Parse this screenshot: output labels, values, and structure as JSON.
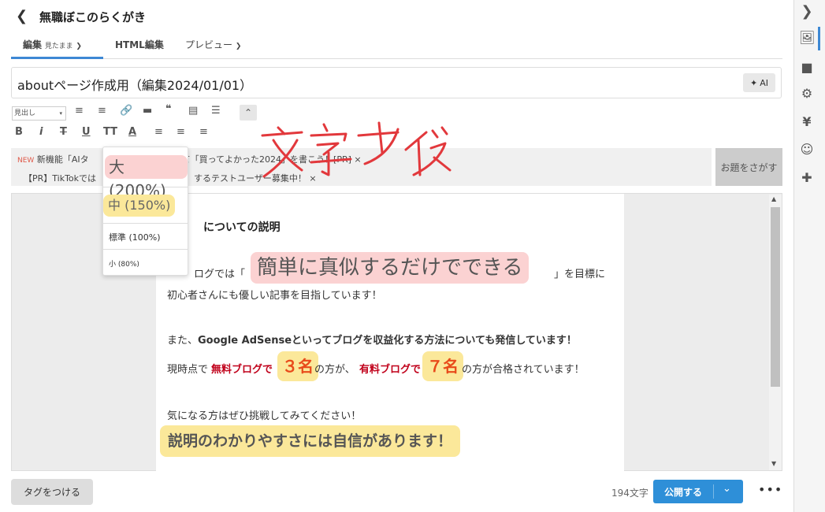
{
  "header": {
    "back_icon": "chevron-left-icon",
    "blog_name": "無職ぼこのらくがき"
  },
  "tabs": [
    {
      "label": "編集",
      "sub": "見たまま"
    },
    {
      "label": "HTML編集"
    },
    {
      "label": "プレビュー"
    }
  ],
  "title": {
    "value": "aboutページ作成用（編集2024/01/01）",
    "ai_label": "AI"
  },
  "toolbar": {
    "heading_select": "見出し"
  },
  "notice": {
    "new_badge": "NEW",
    "line1": "新機能「AIタ",
    "line1_tail": "て「買ってよかった2024」を書こう！[PR]",
    "line2": "【PR】TikTokでは",
    "line2_tail": "するテストユーザー募集中！",
    "close": "×",
    "odai_button": "お題をさがす"
  },
  "font_menu": {
    "items": [
      {
        "label": "大 (200%)"
      },
      {
        "label": "中 (150%)"
      },
      {
        "label": "標準 (100%)"
      },
      {
        "label": "小 (80%)"
      }
    ]
  },
  "editor": {
    "heading": "についての説明",
    "p1_prefix": "ログでは「",
    "p1_big": "簡単に真似するだけでできる",
    "p1_suffix": "」を目標に",
    "p2": "初心者さんにも優しい記事を目指しています！",
    "p3_prefix": "また、",
    "p3_bold": "Google AdSenseといってブログを収益化する方法についても発信しています！",
    "p4_a": "現時点で",
    "p4_b": "無料ブログで",
    "p4_c": "３名",
    "p4_d": "の方が、",
    "p4_e": "有料ブログで",
    "p4_f": "７名",
    "p4_g": "の方が合格されています！",
    "p5": "気になる方はぜひ挑戦してみてください！",
    "p6": "説明のわかりやすさには自信があります！"
  },
  "annotation": {
    "handwritten": "文字サイズ"
  },
  "footer": {
    "tag_button": "タグをつける",
    "char_count": "194文字",
    "publish": "公開する",
    "more": "•••"
  },
  "colors": {
    "accent": "#2e8fd8",
    "highlight_yellow": "#fbe89a",
    "highlight_red": "#fbd2d2",
    "emphasis_red": "#c0001a",
    "annotation_red": "#e2383c"
  }
}
